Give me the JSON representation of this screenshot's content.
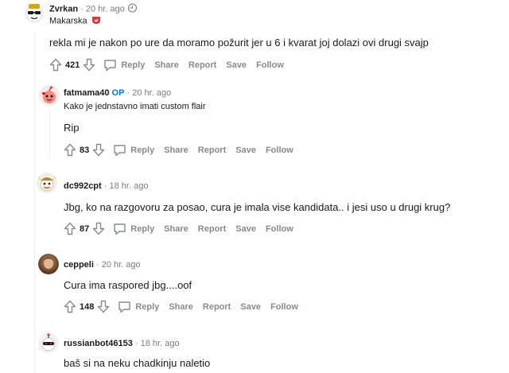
{
  "comments": [
    {
      "username": "Zvrkan",
      "op_badge": "",
      "time": "20 hr. ago",
      "flair": "Makarska",
      "body": "rekla mi je nakon po ure da moramo požurit jer u 6 i kvarat joj dolazi ovi drugi svajp",
      "score": "421",
      "avatar_icon": "sunglasses-avatar-icon"
    },
    {
      "username": "fatmama40",
      "op_badge": "OP",
      "time": "20 hr. ago",
      "flair": "Kako je jednstavno imati custom flair",
      "body": "Rip",
      "score": "83",
      "avatar_icon": "snoo-avatar-icon"
    },
    {
      "username": "dc992cpt",
      "op_badge": "",
      "time": "18 hr. ago",
      "flair": "",
      "body": "Jbg, ko na razgovoru za posao, cura je imala vise kandidata.. i jesi uso u drugi krug?",
      "score": "87",
      "avatar_icon": "viking-avatar-icon"
    },
    {
      "username": "ceppeli",
      "op_badge": "",
      "time": "20 hr. ago",
      "flair": "",
      "body": "Cura ima raspored jbg....oof",
      "score": "148",
      "avatar_icon": "photo-avatar-icon"
    },
    {
      "username": "russianbot46153",
      "op_badge": "",
      "time": "18 hr. ago",
      "flair": "",
      "body": "baš si na neku chadkinju naletio",
      "score": "",
      "avatar_icon": "robot-avatar-icon"
    }
  ],
  "actions": {
    "reply": "Reply",
    "share": "Share",
    "report": "Report",
    "save": "Save",
    "follow": "Follow"
  },
  "separator": "·",
  "colors": {
    "op": "#0079d3",
    "muted": "#878a8c",
    "thread_line": "#edeff1",
    "flair_badge": "#d93a3a"
  }
}
